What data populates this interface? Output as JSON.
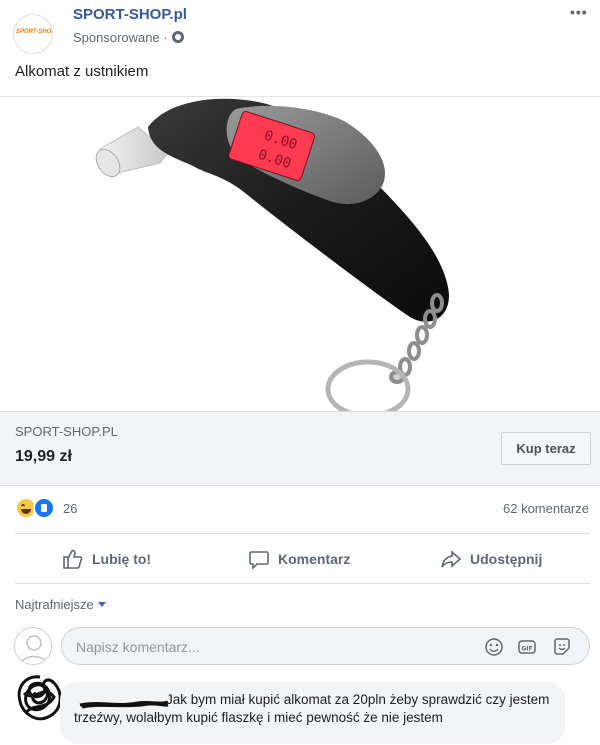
{
  "post": {
    "page_name": "SPORT-SHOP.pl",
    "logo_text": "SPORT-SHOP.pl",
    "sponsored_label": "Sponsorowane ·",
    "more_label": "•••",
    "text": "Alkomat z ustnikiem"
  },
  "product_image": {
    "description_icon": "breathalyzer-image",
    "display_line1": "0.00",
    "display_line2": "0.00"
  },
  "link": {
    "domain": "SPORT-SHOP.PL",
    "price": "19,99 zł",
    "cta_label": "Kup teraz"
  },
  "reactions": {
    "types": [
      "haha",
      "like"
    ],
    "count": "26",
    "comments_label": "62 komentarze"
  },
  "actions": {
    "like_label": "Lubię to!",
    "comment_label": "Komentarz",
    "share_label": "Udostępnij"
  },
  "comments": {
    "sort_label": "Najtrafniejsze",
    "input_placeholder": "Napisz komentarz...",
    "input_icons": [
      "emoji-icon",
      "gif-icon",
      "sticker-icon"
    ],
    "items": [
      {
        "text": "Jak bym miał kupić alkomat za 20pln żeby sprawdzić czy jestem trzeźwy, wolałbym kupić flaszkę i mieć pewność że nie jestem"
      }
    ]
  },
  "colors": {
    "link_blue": "#385898",
    "secondary_text": "#606770",
    "like_blue": "#1877f2",
    "display_red": "#ff3b52"
  }
}
